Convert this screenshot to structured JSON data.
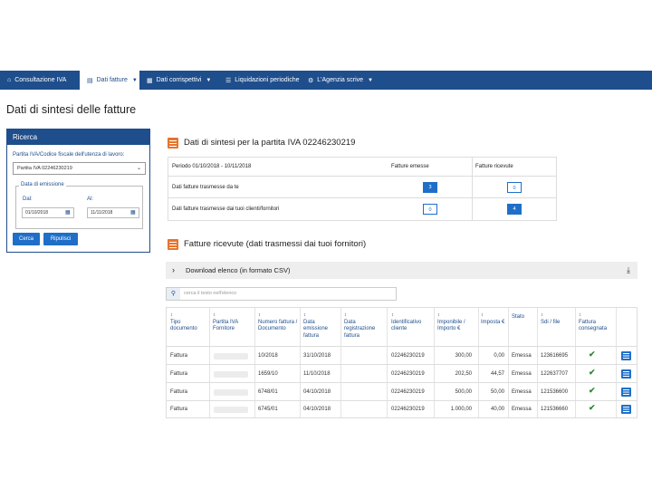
{
  "nav": {
    "items": [
      {
        "label": "Consultazione IVA",
        "icon": "home-icon",
        "caret": false,
        "active": false
      },
      {
        "label": "Dati fatture",
        "icon": "document-icon",
        "caret": true,
        "active": true
      },
      {
        "label": "Dati corrispettivi",
        "icon": "grid-icon",
        "caret": true,
        "active": false
      },
      {
        "label": "Liquidazioni periodiche",
        "icon": "list-icon",
        "caret": false,
        "active": false
      },
      {
        "label": "L'Agenzia scrive",
        "icon": "gear-icon",
        "caret": true,
        "active": false
      }
    ]
  },
  "page_title": "Dati di sintesi delle fatture",
  "ricerca": {
    "title": "Ricerca",
    "field_label": "Partita IVA/Codice fiscale dell'utenza di lavoro:",
    "select_value": "Partita IVA 02246230219",
    "legend": "Data di emissione",
    "dal_label": "Dal:",
    "al_label": "Al:",
    "dal_value": "01/10/2018",
    "al_value": "11/11/2018",
    "cerca_label": "Cerca",
    "ripulisci_label": "Ripulisci"
  },
  "sintesi": {
    "title": "Dati di sintesi per la partita IVA 02246230219",
    "periodo": "Periodo 01/10/2018 - 10/11/2018",
    "col_emesse": "Fatture emesse",
    "col_ricevute": "Fatture ricevute",
    "rows": [
      {
        "label": "Dati fatture trasmesse da te",
        "emesse": "3",
        "ricevute": "0"
      },
      {
        "label": "Dati fatture trasmesse dai tuoi clienti/fornitori",
        "emesse": "0",
        "ricevute": "4"
      }
    ]
  },
  "ricevute": {
    "title": "Fatture ricevute (dati trasmessi dai tuoi fornitori)",
    "download_label": "Download elenco (in formato CSV)",
    "search_placeholder": "cerca il testo nell'elenco",
    "columns": [
      "Tipo documento",
      "Partita IVA Fornitore",
      "Numero fattura / Documento",
      "Data emissione fattura",
      "Data registrazione fattura",
      "Identificativo cliente",
      "Imponibile / Importo €",
      "Imposta €",
      "Stato",
      "Sdi / file",
      "Fattura consegnata"
    ],
    "rows": [
      {
        "tipo": "Fattura",
        "numero": "10/2018",
        "data": "31/10/2018",
        "cliente": "02246230219",
        "imponibile": "300,00",
        "imposta": "0,00",
        "stato": "Emessa",
        "sdi": "123616695"
      },
      {
        "tipo": "Fattura",
        "numero": "1659/10",
        "data": "11/10/2018",
        "cliente": "02246230219",
        "imponibile": "202,50",
        "imposta": "44,57",
        "stato": "Emessa",
        "sdi": "122637707"
      },
      {
        "tipo": "Fattura",
        "numero": "6748/01",
        "data": "04/10/2018",
        "cliente": "02246230219",
        "imponibile": "500,00",
        "imposta": "50,00",
        "stato": "Emessa",
        "sdi": "121536600"
      },
      {
        "tipo": "Fattura",
        "numero": "6745/01",
        "data": "04/10/2018",
        "cliente": "02246230219",
        "imponibile": "1.000,00",
        "imposta": "40,00",
        "stato": "Emessa",
        "sdi": "121536660"
      }
    ]
  },
  "colors": {
    "primary": "#1f4e8c",
    "accent": "#1f6fc8",
    "orange": "#e8742a",
    "check": "#2e8b2e"
  }
}
